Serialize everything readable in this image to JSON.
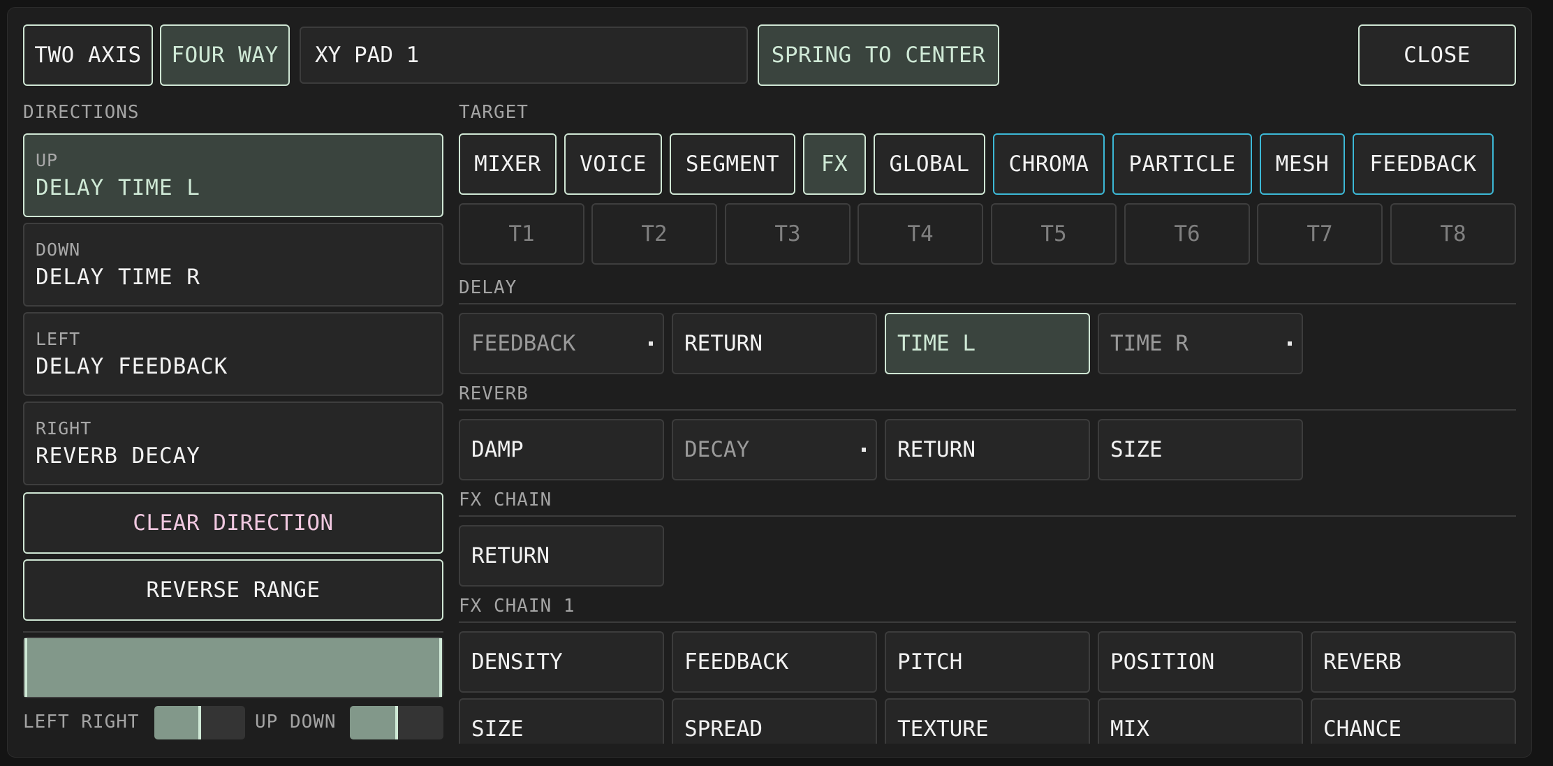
{
  "mode_buttons": [
    {
      "label": "TWO AXIS",
      "active": false
    },
    {
      "label": "FOUR WAY",
      "active": true
    }
  ],
  "pad_name": "XY PAD 1",
  "spring_label": "SPRING TO CENTER",
  "close_label": "CLOSE",
  "directions": {
    "label": "DIRECTIONS",
    "items": [
      {
        "key": "UP",
        "value": "DELAY TIME L",
        "active": true
      },
      {
        "key": "DOWN",
        "value": "DELAY TIME R",
        "active": false
      },
      {
        "key": "LEFT",
        "value": "DELAY FEEDBACK",
        "active": false
      },
      {
        "key": "RIGHT",
        "value": "REVERB DECAY",
        "active": false
      }
    ],
    "clear_label": "CLEAR DIRECTION",
    "reverse_label": "REVERSE RANGE"
  },
  "range_bar": {
    "min": 0.0,
    "max": 1.0
  },
  "axis_meters": [
    {
      "label": "LEFT RIGHT",
      "value": 0.5
    },
    {
      "label": "UP DOWN",
      "value": 0.5
    }
  ],
  "target": {
    "label": "TARGET",
    "categories": [
      {
        "label": "MIXER",
        "active": false,
        "accent": "default"
      },
      {
        "label": "VOICE",
        "active": false,
        "accent": "default"
      },
      {
        "label": "SEGMENT",
        "active": false,
        "accent": "default"
      },
      {
        "label": "FX",
        "active": true,
        "accent": "default"
      },
      {
        "label": "GLOBAL",
        "active": false,
        "accent": "default"
      },
      {
        "label": "CHROMA",
        "active": false,
        "accent": "cyan"
      },
      {
        "label": "PARTICLE",
        "active": false,
        "accent": "cyan"
      },
      {
        "label": "MESH",
        "active": false,
        "accent": "cyan"
      },
      {
        "label": "FEEDBACK",
        "active": false,
        "accent": "cyan"
      }
    ],
    "tracks": [
      "T1",
      "T2",
      "T3",
      "T4",
      "T5",
      "T6",
      "T7",
      "T8"
    ]
  },
  "sections": [
    {
      "title": "DELAY",
      "params": [
        {
          "label": "FEEDBACK",
          "state": "assigned"
        },
        {
          "label": "RETURN",
          "state": "normal"
        },
        {
          "label": "TIME L",
          "state": "active"
        },
        {
          "label": "TIME R",
          "state": "assigned"
        }
      ]
    },
    {
      "title": "REVERB",
      "params": [
        {
          "label": "DAMP",
          "state": "normal"
        },
        {
          "label": "DECAY",
          "state": "assigned"
        },
        {
          "label": "RETURN",
          "state": "normal"
        },
        {
          "label": "SIZE",
          "state": "normal"
        }
      ]
    },
    {
      "title": "FX CHAIN",
      "params": [
        {
          "label": "RETURN",
          "state": "normal"
        }
      ]
    },
    {
      "title": "FX CHAIN 1",
      "params": [
        {
          "label": "DENSITY",
          "state": "normal"
        },
        {
          "label": "FEEDBACK",
          "state": "normal"
        },
        {
          "label": "PITCH",
          "state": "normal"
        },
        {
          "label": "POSITION",
          "state": "normal"
        },
        {
          "label": "REVERB",
          "state": "normal"
        },
        {
          "label": "SIZE",
          "state": "normal"
        },
        {
          "label": "SPREAD",
          "state": "normal"
        },
        {
          "label": "TEXTURE",
          "state": "normal"
        },
        {
          "label": "MIX",
          "state": "normal"
        },
        {
          "label": "CHANCE",
          "state": "normal"
        }
      ]
    }
  ],
  "colors": {
    "accent_mint": "#cfe6d4",
    "accent_cyan": "#3cb8d6",
    "clear_text_pink": "#f0c8e0",
    "active_fill": "#3a443e",
    "range_fill": "#82988a"
  }
}
